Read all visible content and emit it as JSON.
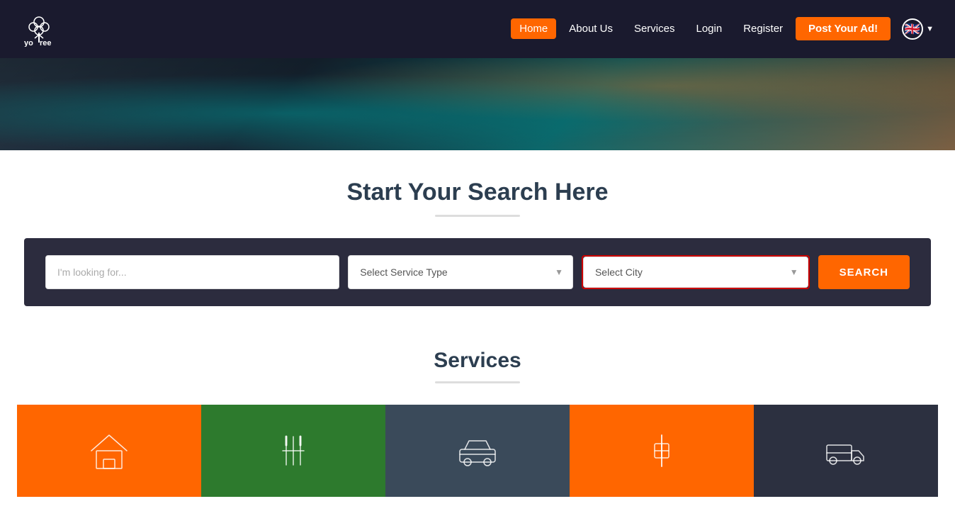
{
  "site": {
    "logo_text": "yo tree",
    "logo_icon": "🌿"
  },
  "navbar": {
    "links": [
      {
        "label": "Home",
        "active": true
      },
      {
        "label": "About Us",
        "active": false
      },
      {
        "label": "Services",
        "active": false
      },
      {
        "label": "Login",
        "active": false
      },
      {
        "label": "Register",
        "active": false
      }
    ],
    "post_ad_label": "Post Your Ad!",
    "lang_flag": "🇬🇧"
  },
  "search": {
    "title": "Start Your Search Here",
    "input_placeholder": "I'm looking for...",
    "service_type_placeholder": "Select Service Type",
    "city_placeholder": "Select City",
    "button_label": "SEARCH"
  },
  "services_section": {
    "title": "Services"
  },
  "service_cards": [
    {
      "type": "home",
      "bg": "card-orange"
    },
    {
      "type": "food",
      "bg": "card-green"
    },
    {
      "type": "car",
      "bg": "card-dark"
    },
    {
      "type": "tools",
      "bg": "card-orange2"
    },
    {
      "type": "truck",
      "bg": "card-dark2"
    }
  ]
}
